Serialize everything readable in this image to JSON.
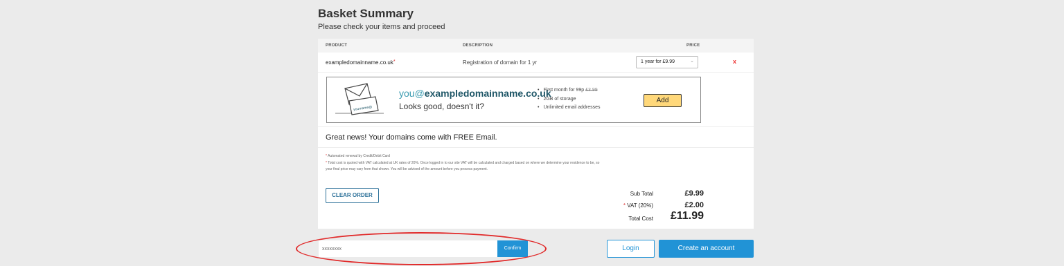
{
  "header": {
    "title": "Basket Summary",
    "subtitle": "Please check your items and proceed"
  },
  "table": {
    "columns": {
      "product": "PRODUCT",
      "description": "DESCRIPTION",
      "price": "PRICE"
    },
    "row": {
      "product": "exampledomainname.co.uk",
      "product_marker": "*",
      "description": "Registration of domain for 1 yr",
      "price_select": "1 year for £9.99",
      "remove": "x"
    }
  },
  "promo": {
    "envelope_text": "yourname@",
    "email_prefix": "you@",
    "email_domain": "exampledomainname.co.uk",
    "tagline": "Looks good, doesn't it?",
    "bullet1_text": "First month for 99p",
    "bullet1_strike": "£3.99",
    "bullet2": "2GB of storage",
    "bullet3": "Unlimited email addresses",
    "add_label": "Add"
  },
  "free_email": "Great news! Your domains come with FREE Email.",
  "footnotes": {
    "marker": "*",
    "note1": "Automated renewal by Credit/Debit Card",
    "note2": "Total cost is quoted with VAT calculated at UK rates of 20%. Once logged in to our site VAT will be calculated and charged based on where we determine your residence to be, so your final price may vary from that shown. You will be advised of the amount before you process payment."
  },
  "clear_order": "CLEAR ORDER",
  "totals": {
    "subtotal_label": "Sub Total",
    "subtotal_value": "£9.99",
    "vat_marker": "*",
    "vat_label": "VAT (20%)",
    "vat_value": "£2.00",
    "total_label": "Total Cost",
    "total_value": "£11.99"
  },
  "voucher": {
    "value": "xxxxxxxx",
    "confirm_label": "Confirm"
  },
  "auth": {
    "login_label": "Login",
    "create_label": "Create an account"
  },
  "colors": {
    "accent": "#2193d6",
    "add_button": "#ffd87a",
    "highlight_ellipse": "#e12b2b",
    "remove": "#e33333"
  }
}
